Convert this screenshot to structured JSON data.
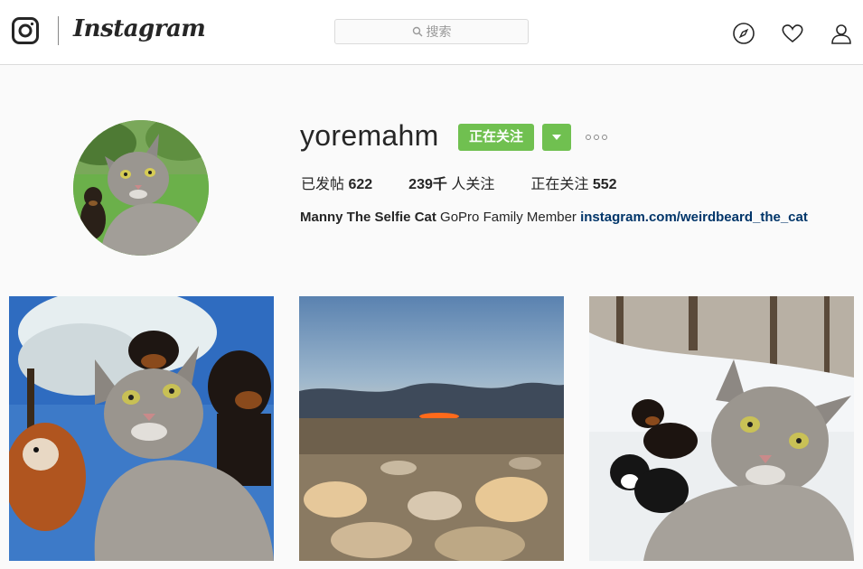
{
  "header": {
    "brand": "Instagram",
    "search_placeholder": "搜索",
    "icons": [
      "instagram-logo-icon",
      "search-icon",
      "compass-icon",
      "heart-icon",
      "user-icon"
    ]
  },
  "profile": {
    "username": "yoremahm",
    "follow_button": "正在关注",
    "stats": {
      "posts_label": "已发帖",
      "posts_value": "622",
      "followers_value": "239千",
      "followers_label": "人关注",
      "following_label": "正在关注",
      "following_value": "552"
    },
    "bio": {
      "name": "Manny The Selfie Cat",
      "text": "GoPro Family Member",
      "link": "instagram.com/weirdbeard_the_cat"
    }
  },
  "colors": {
    "accent_green": "#70c050",
    "link": "#003569",
    "border": "#dbdbdb"
  }
}
